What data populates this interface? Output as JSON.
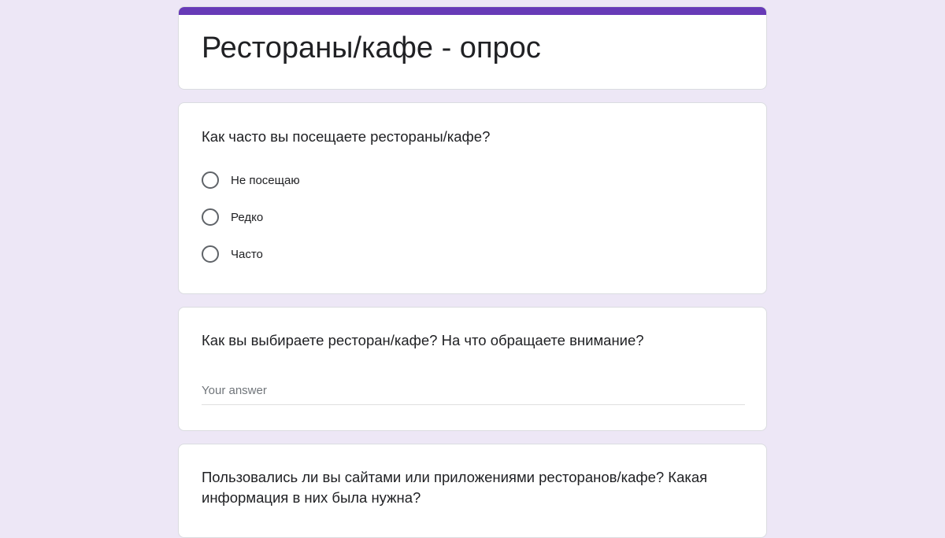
{
  "form": {
    "title": "Рестораны/кафе - опрос",
    "accent_color": "#673ab7",
    "background_color": "#ede7f6"
  },
  "questions": [
    {
      "title": "Как часто вы посещаете рестораны/кафе?",
      "type": "radio",
      "options": [
        "Не посещаю",
        "Редко",
        "Часто"
      ]
    },
    {
      "title": "Как вы выбираете ресторан/кафе? На что обращаете внимание?",
      "type": "short-answer",
      "placeholder": "Your answer"
    },
    {
      "title": "Пользовались ли вы сайтами или приложениями ресторанов/кафе? Какая информация в них была нужна?",
      "type": "text"
    }
  ]
}
